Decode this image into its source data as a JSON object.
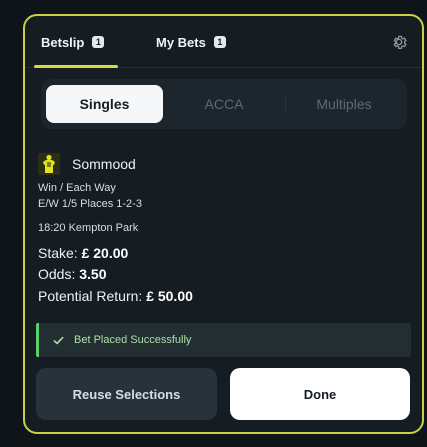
{
  "header": {
    "tabs": [
      {
        "label": "Betslip",
        "count": "1"
      },
      {
        "label": "My Bets",
        "count": "1"
      }
    ]
  },
  "segments": [
    "Singles",
    "ACCA",
    "Multiples"
  ],
  "selection": {
    "horse": "Sommood",
    "bet_type": "Win / Each Way",
    "terms": "E/W 1/5 Places 1-2-3",
    "race": "18:20 Kempton Park",
    "stake_label": "Stake:",
    "stake": "£ 20.00",
    "odds_label": "Odds:",
    "odds": "3.50",
    "return_label": "Potential Return:",
    "return": "£ 50.00"
  },
  "status": {
    "message": "Bet Placed Successfully"
  },
  "actions": {
    "reuse": "Reuse Selections",
    "done": "Done"
  },
  "colors": {
    "accent": "#d4da3f",
    "success": "#5ccf6e",
    "jersey": "#e3e21f"
  },
  "icons": {
    "settings": "gear-icon",
    "silks": "jersey-icon",
    "status": "check-icon"
  }
}
